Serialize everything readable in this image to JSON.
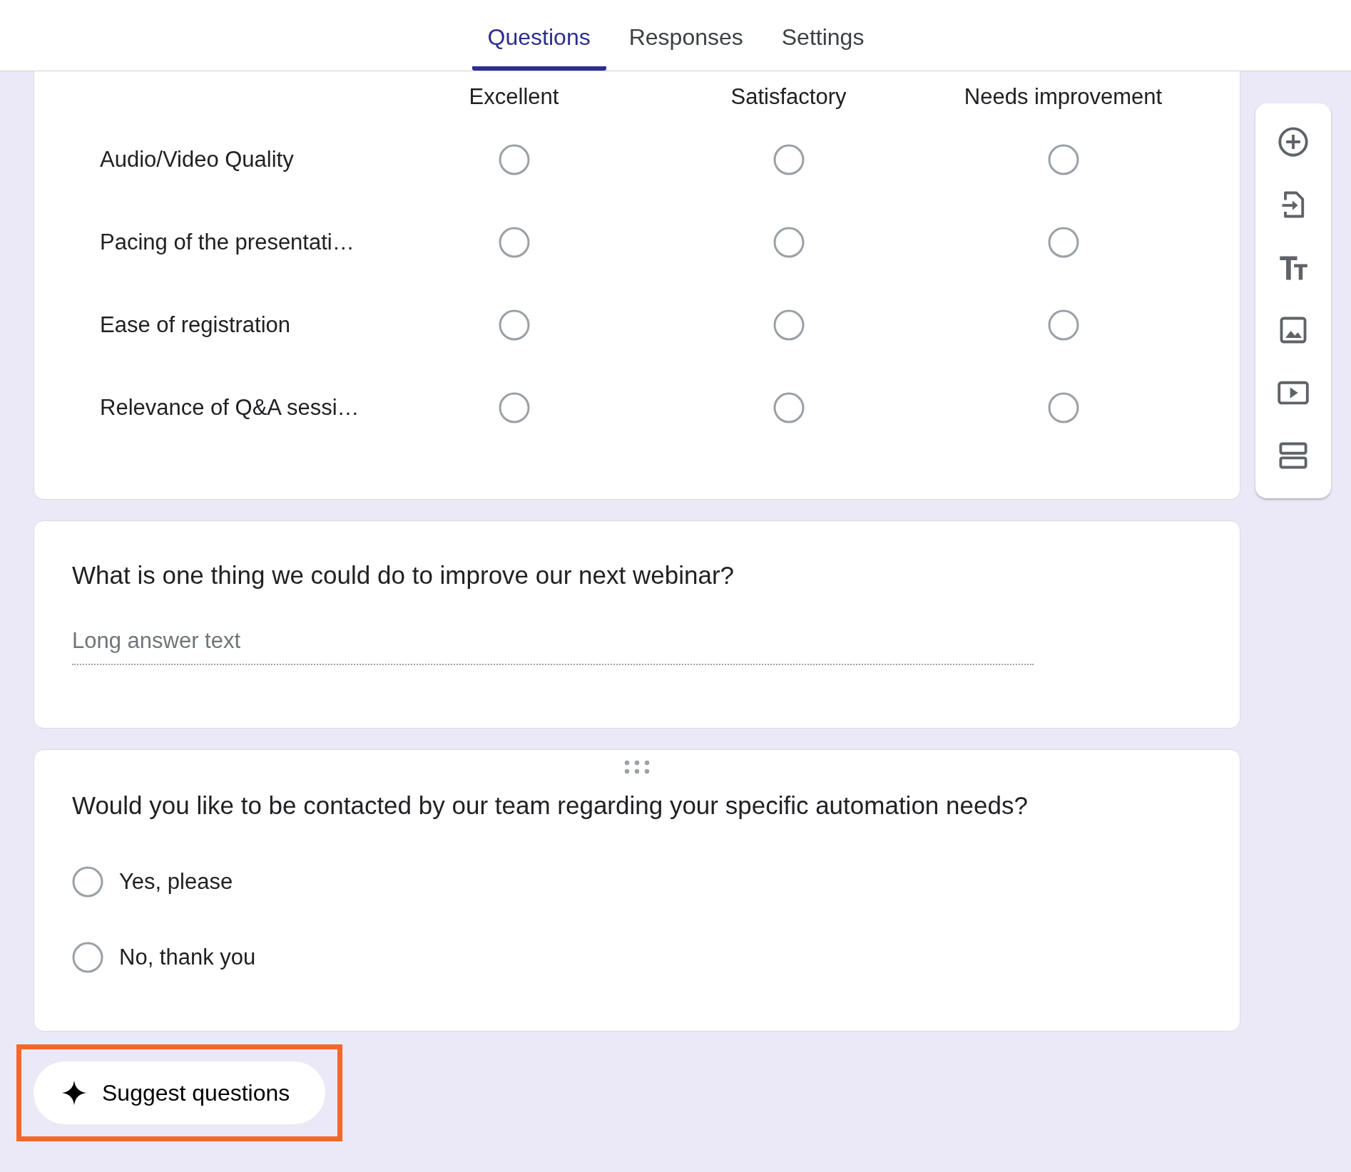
{
  "tabs": [
    {
      "label": "Questions",
      "selected": true
    },
    {
      "label": "Responses",
      "selected": false
    },
    {
      "label": "Settings",
      "selected": false
    }
  ],
  "grid_question": {
    "columns": [
      "Excellent",
      "Satisfactory",
      "Needs improvement"
    ],
    "rows": [
      {
        "label": "Audio/Video Quality",
        "choices": [
          {
            "selected": false
          },
          {
            "selected": false
          },
          {
            "selected": false
          }
        ]
      },
      {
        "label": "Pacing of the presentati…",
        "choices": [
          {
            "selected": false
          },
          {
            "selected": false
          },
          {
            "selected": false
          }
        ]
      },
      {
        "label": "Ease of registration",
        "choices": [
          {
            "selected": false
          },
          {
            "selected": false
          },
          {
            "selected": false
          }
        ]
      },
      {
        "label": "Relevance of Q&A sessi…",
        "choices": [
          {
            "selected": false
          },
          {
            "selected": false
          },
          {
            "selected": false
          }
        ]
      }
    ]
  },
  "paragraph_question": {
    "title": "What is one thing we could do to improve our next webinar?",
    "placeholder": "Long answer text"
  },
  "choice_question": {
    "title": "Would you like to be contacted by our team regarding your specific automation needs?",
    "options": [
      {
        "label": "Yes, please",
        "selected": false
      },
      {
        "label": "No, thank you",
        "selected": false
      }
    ]
  },
  "toolbar": [
    {
      "kind": "add"
    },
    {
      "kind": "import"
    },
    {
      "kind": "title"
    },
    {
      "kind": "image"
    },
    {
      "kind": "video"
    },
    {
      "kind": "section"
    }
  ],
  "suggest_button": {
    "label": "Suggest questions",
    "highlighted": true
  }
}
